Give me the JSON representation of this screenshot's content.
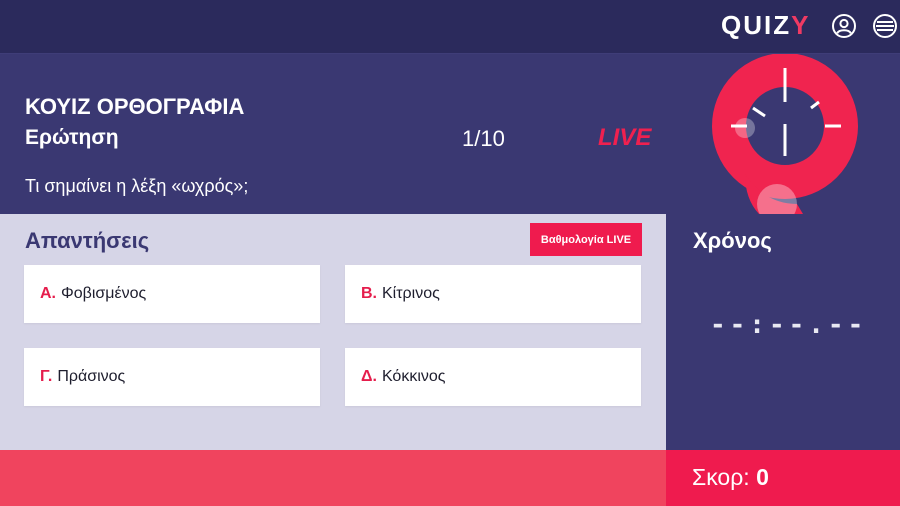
{
  "header": {
    "logo_prefix": "QUIZ",
    "logo_suffix": "Y",
    "icons": {
      "user": "user-circle-icon",
      "menu": "hamburger-circle-icon"
    }
  },
  "quiz": {
    "title": "ΚΟΥΙΖ ΟΡΘΟΓΡΑΦΙΑ",
    "question_label": "Ερώτηση",
    "counter": "1/10",
    "live": "LIVE",
    "question": "Τι σημαίνει η λέξη «ωχρός»;"
  },
  "answers": {
    "title": "Απαντήσεις",
    "live_button": "Βαθμολογία LIVE",
    "options": [
      {
        "letter": "Α.",
        "text": "Φοβισμένος"
      },
      {
        "letter": "Β.",
        "text": "Κίτρινος"
      },
      {
        "letter": "Γ.",
        "text": "Πράσινος"
      },
      {
        "letter": "Δ.",
        "text": "Κόκκινος"
      }
    ]
  },
  "timer": {
    "title": "Χρόνος",
    "display": "--:--.--"
  },
  "score": {
    "label": "Σκορ:",
    "value": "0"
  },
  "colors": {
    "navy": "#2b2a5c",
    "purple": "#3a3872",
    "lavender": "#d6d5e7",
    "accent": "#ef1b4e"
  }
}
